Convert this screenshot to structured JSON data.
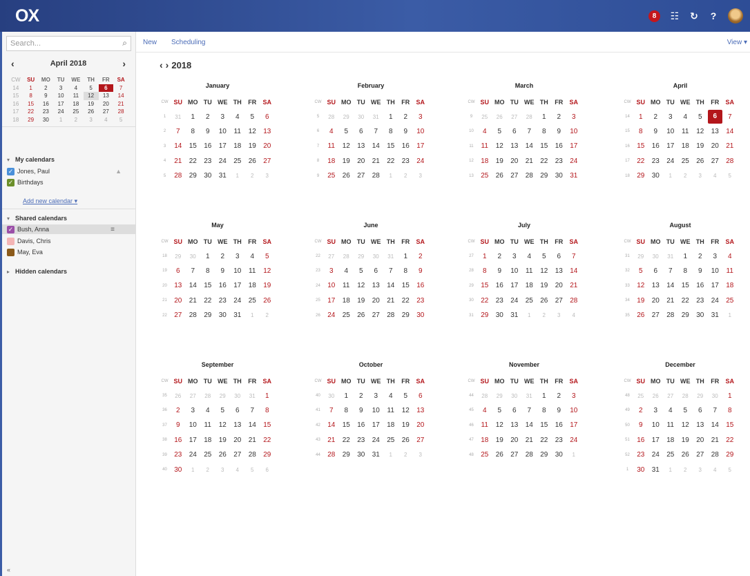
{
  "app": {
    "logo": "OX"
  },
  "topbar": {
    "notifications": "8",
    "icons": [
      "apps-grid-icon",
      "refresh-icon",
      "help-icon",
      "user-avatar"
    ],
    "help_label": "?",
    "accent": "#c4161c"
  },
  "search": {
    "placeholder": "Search..."
  },
  "mini_calendar": {
    "title": "April 2018",
    "headers": [
      "CW",
      "SU",
      "MO",
      "TU",
      "WE",
      "TH",
      "FR",
      "SA"
    ],
    "rows": [
      [
        "14",
        "1",
        "2",
        "3",
        "4",
        "5",
        "6",
        "7"
      ],
      [
        "15",
        "8",
        "9",
        "10",
        "11",
        "12",
        "13",
        "14"
      ],
      [
        "16",
        "15",
        "16",
        "17",
        "18",
        "19",
        "20",
        "21"
      ],
      [
        "17",
        "22",
        "23",
        "24",
        "25",
        "26",
        "27",
        "28"
      ],
      [
        "18",
        "29",
        "30",
        "1",
        "2",
        "3",
        "4",
        "5"
      ]
    ],
    "today": "6",
    "selected": "12"
  },
  "sidebar": {
    "my_calendars": {
      "label": "My calendars",
      "items": [
        {
          "name": "Jones, Paul",
          "color": "#4a90d9",
          "checked": true
        },
        {
          "name": "Birthdays",
          "color": "#6b8f2a",
          "checked": true
        }
      ]
    },
    "add_calendar": "Add new calendar",
    "shared_calendars": {
      "label": "Shared calendars",
      "items": [
        {
          "name": "Bush, Anna",
          "color": "#9b4fa8",
          "checked": true
        },
        {
          "name": "Davis, Chris",
          "color": "#f4b5b5",
          "checked": false
        },
        {
          "name": "May, Eva",
          "color": "#8b5a1a",
          "checked": false
        }
      ]
    },
    "hidden_calendars": {
      "label": "Hidden calendars"
    },
    "collapse": "«"
  },
  "toolbar": {
    "new_label": "New",
    "scheduling_label": "Scheduling",
    "view_label": "View"
  },
  "year_view": {
    "year": "2018",
    "today": {
      "month": "April",
      "day": "6"
    },
    "weekday_headers": [
      "SU",
      "MO",
      "TU",
      "WE",
      "TH",
      "FR",
      "SA"
    ],
    "cw_header": "CW",
    "months": [
      {
        "name": "January",
        "lead": [
          "31"
        ],
        "days": 31,
        "first_cw": 1
      },
      {
        "name": "February",
        "lead": [
          "28",
          "29",
          "30",
          "31"
        ],
        "days": 28,
        "first_cw": 5
      },
      {
        "name": "March",
        "lead": [
          "25",
          "26",
          "27",
          "28"
        ],
        "days": 31,
        "first_cw": 9
      },
      {
        "name": "April",
        "lead": [],
        "days": 30,
        "first_cw": 14
      },
      {
        "name": "May",
        "lead": [
          "29",
          "30"
        ],
        "days": 31,
        "first_cw": 18
      },
      {
        "name": "June",
        "lead": [
          "27",
          "28",
          "29",
          "30",
          "31"
        ],
        "days": 30,
        "first_cw": 22
      },
      {
        "name": "July",
        "lead": [],
        "days": 31,
        "first_cw": 27
      },
      {
        "name": "August",
        "lead": [
          "29",
          "30",
          "31"
        ],
        "days": 31,
        "first_cw": 31
      },
      {
        "name": "September",
        "lead": [
          "26",
          "27",
          "28",
          "29",
          "30",
          "31"
        ],
        "days": 30,
        "first_cw": 35
      },
      {
        "name": "October",
        "lead": [
          "30"
        ],
        "days": 31,
        "first_cw": 40
      },
      {
        "name": "November",
        "lead": [
          "28",
          "29",
          "30",
          "31"
        ],
        "days": 30,
        "first_cw": 44
      },
      {
        "name": "December",
        "lead": [
          "25",
          "26",
          "27",
          "28",
          "29",
          "30"
        ],
        "days": 31,
        "first_cw": 48
      }
    ]
  }
}
